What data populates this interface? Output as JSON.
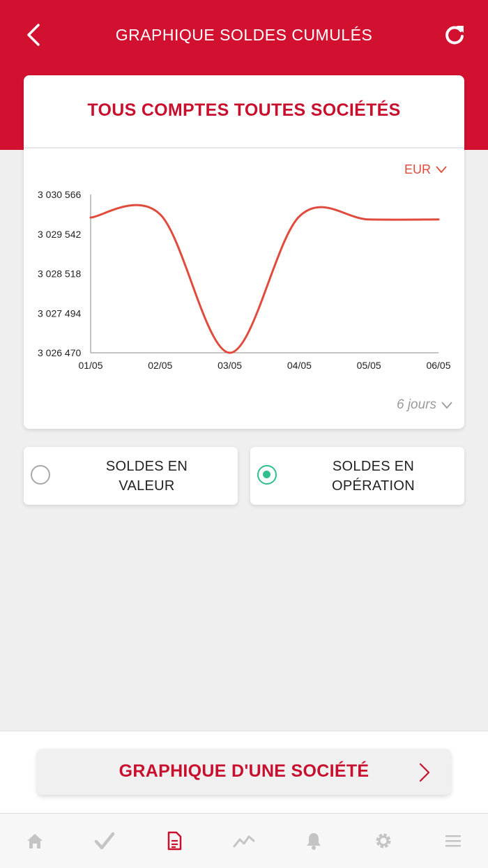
{
  "header": {
    "title": "GRAPHIQUE SOLDES CUMULÉS"
  },
  "card": {
    "title": "TOUS COMPTES TOUTES SOCIÉTÉS",
    "currency": "EUR",
    "period": "6 jours"
  },
  "chart_data": {
    "type": "line",
    "title": "",
    "x": [
      "01/05",
      "02/05",
      "03/05",
      "04/05",
      "05/05",
      "06/05"
    ],
    "series": [
      {
        "values": [
          3029970,
          3030050,
          3026470,
          3030000,
          3029920,
          3029920
        ]
      }
    ],
    "yticks": [
      "3 026 470",
      "3 027 494",
      "3 028 518",
      "3 029 542",
      "3 030 566"
    ],
    "ylim": [
      3026470,
      3030566
    ],
    "grid": false,
    "line_color": "#e14b3d"
  },
  "options": [
    {
      "line1": "SOLDES EN",
      "line2": "VALEUR",
      "selected": false
    },
    {
      "line1": "SOLDES EN",
      "line2": "OPÉRATION",
      "selected": true
    }
  ],
  "bottom": {
    "button_label": "GRAPHIQUE D'UNE SOCIÉTÉ"
  },
  "tabs": [
    {
      "icon": "home-icon",
      "active": false
    },
    {
      "icon": "check-icon",
      "active": false
    },
    {
      "icon": "document-icon",
      "active": true
    },
    {
      "icon": "trend-icon",
      "active": false
    },
    {
      "icon": "bell-icon",
      "active": false
    },
    {
      "icon": "gear-icon",
      "active": false
    },
    {
      "icon": "menu-icon",
      "active": false
    }
  ],
  "colors": {
    "brand": "#d21130",
    "accent_red": "#c8102e",
    "selected_green": "#2fbf8f",
    "tab_inactive": "#c4c4c4"
  }
}
